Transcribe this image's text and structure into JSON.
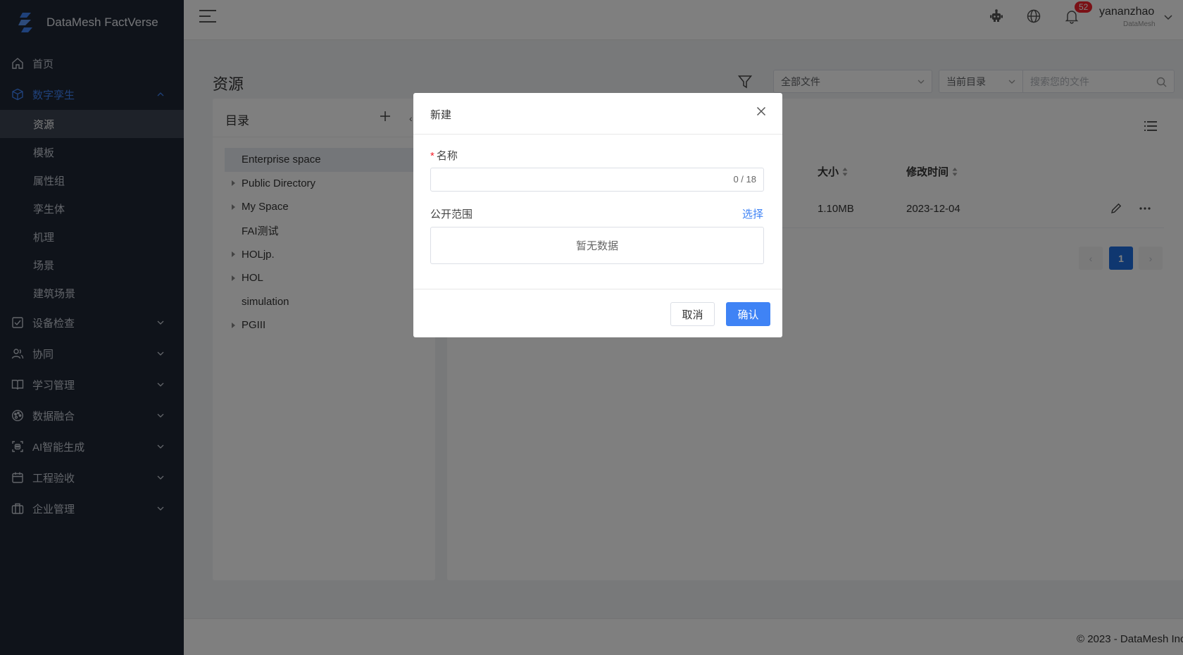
{
  "app": {
    "name": "DataMesh FactVerse"
  },
  "sidebar": {
    "items": [
      {
        "label": "首页",
        "icon": "home-icon"
      },
      {
        "label": "数字孪生",
        "icon": "cube-icon",
        "expanded": true
      },
      {
        "label": "设备检查",
        "icon": "checkbox-icon"
      },
      {
        "label": "协同",
        "icon": "users-icon"
      },
      {
        "label": "学习管理",
        "icon": "book-icon"
      },
      {
        "label": "数据融合",
        "icon": "palette-icon"
      },
      {
        "label": "AI智能生成",
        "icon": "ai-icon"
      },
      {
        "label": "工程验收",
        "icon": "calendar-icon"
      },
      {
        "label": "企业管理",
        "icon": "briefcase-icon"
      }
    ],
    "sub_items": [
      "资源",
      "模板",
      "属性组",
      "孪生体",
      "机理",
      "场景",
      "建筑场景"
    ],
    "active_sub_item": "资源"
  },
  "header": {
    "notification_count": "52",
    "user_name": "yananzhao",
    "user_org": "DataMesh"
  },
  "page": {
    "title": "资源",
    "file_type_select": "全部文件",
    "scope_select": "当前目录",
    "search_placeholder": "搜索您的文件"
  },
  "directory": {
    "title": "目录",
    "collapse_glyph": "‹",
    "nodes": [
      {
        "label": "Enterprise space",
        "has_children": false,
        "selected": true
      },
      {
        "label": "Public Directory",
        "has_children": true
      },
      {
        "label": "My Space",
        "has_children": true
      },
      {
        "label": "FAI测试",
        "has_children": false
      },
      {
        "label": "HOLjp.",
        "has_children": true
      },
      {
        "label": "HOL",
        "has_children": true
      },
      {
        "label": "simulation",
        "has_children": false
      },
      {
        "label": "PGIII",
        "has_children": true
      }
    ]
  },
  "file_table": {
    "columns": [
      "大小",
      "修改时间"
    ],
    "rows": [
      {
        "size": "1.10MB",
        "modified": "2023-12-04"
      }
    ],
    "pagination": {
      "current_page": "1",
      "prev": "‹",
      "next": "›"
    }
  },
  "footer": {
    "copyright": "© 2023 - DataMesh Inc"
  },
  "modal": {
    "title": "新建",
    "name_label": "名称",
    "required_mark": "*",
    "name_value": "",
    "char_count": "0 / 18",
    "scope_label": "公开范围",
    "scope_select_link": "选择",
    "scope_empty": "暂无数据",
    "cancel_label": "取消",
    "confirm_label": "确认"
  },
  "colors": {
    "sidebar_bg": "#1e2634",
    "accent": "#3f83f5",
    "badge": "#f5222d",
    "page_bg": "#f0f2f5"
  }
}
